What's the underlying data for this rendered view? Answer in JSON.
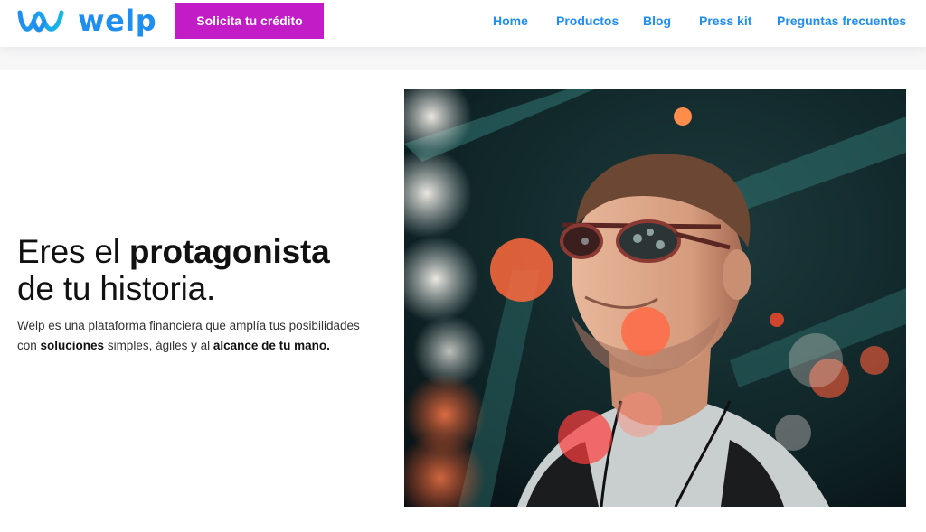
{
  "brand": {
    "name": "welp",
    "color": "#1f8ef1",
    "cta_color": "#c21cc6"
  },
  "header": {
    "cta_label": "Solicita tu crédito",
    "nav": [
      {
        "label": "Home"
      },
      {
        "label": "Productos"
      },
      {
        "label": "Blog"
      },
      {
        "label": "Press kit"
      },
      {
        "label": "Preguntas frecuentes"
      }
    ]
  },
  "hero": {
    "title_part1": "Eres el ",
    "title_bold": "protagonista",
    "title_part2": "de tu historia.",
    "subtitle": {
      "p1": "Welp es una plataforma financiera que amplía tus posibilidades con ",
      "b1": "soluciones",
      "p2": " simples, ágiles y al ",
      "b2": "alcance de tu mano."
    },
    "image": {
      "subject": "young man wearing sunglasses with bokeh lights",
      "icon": "hero-photo"
    }
  }
}
